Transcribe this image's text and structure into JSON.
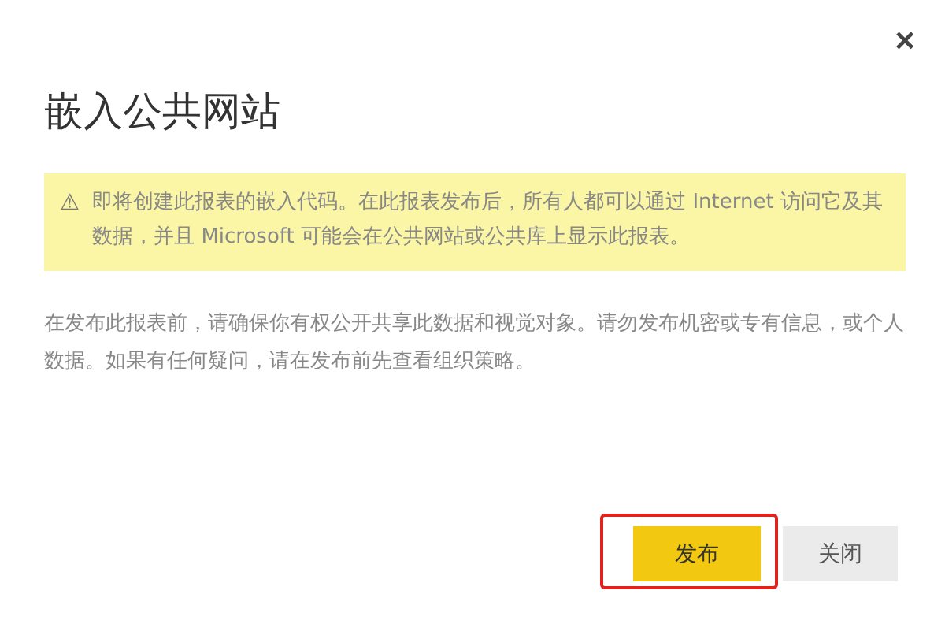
{
  "dialog": {
    "close": "×",
    "title": "嵌入公共网站",
    "warning": {
      "icon": "⚠",
      "text": "即将创建此报表的嵌入代码。在此报表发布后，所有人都可以通过 Internet 访问它及其数据，并且 Microsoft 可能会在公共网站或公共库上显示此报表。"
    },
    "body": "在发布此报表前，请确保你有权公开共享此数据和视觉对象。请勿发布机密或专有信息，或个人数据。如果有任何疑问，请在发布前先查看组织策略。",
    "buttons": [
      {
        "label": "发布",
        "kind": "primary",
        "highlighted": true
      },
      {
        "label": "关闭",
        "kind": "secondary",
        "highlighted": false
      }
    ]
  }
}
